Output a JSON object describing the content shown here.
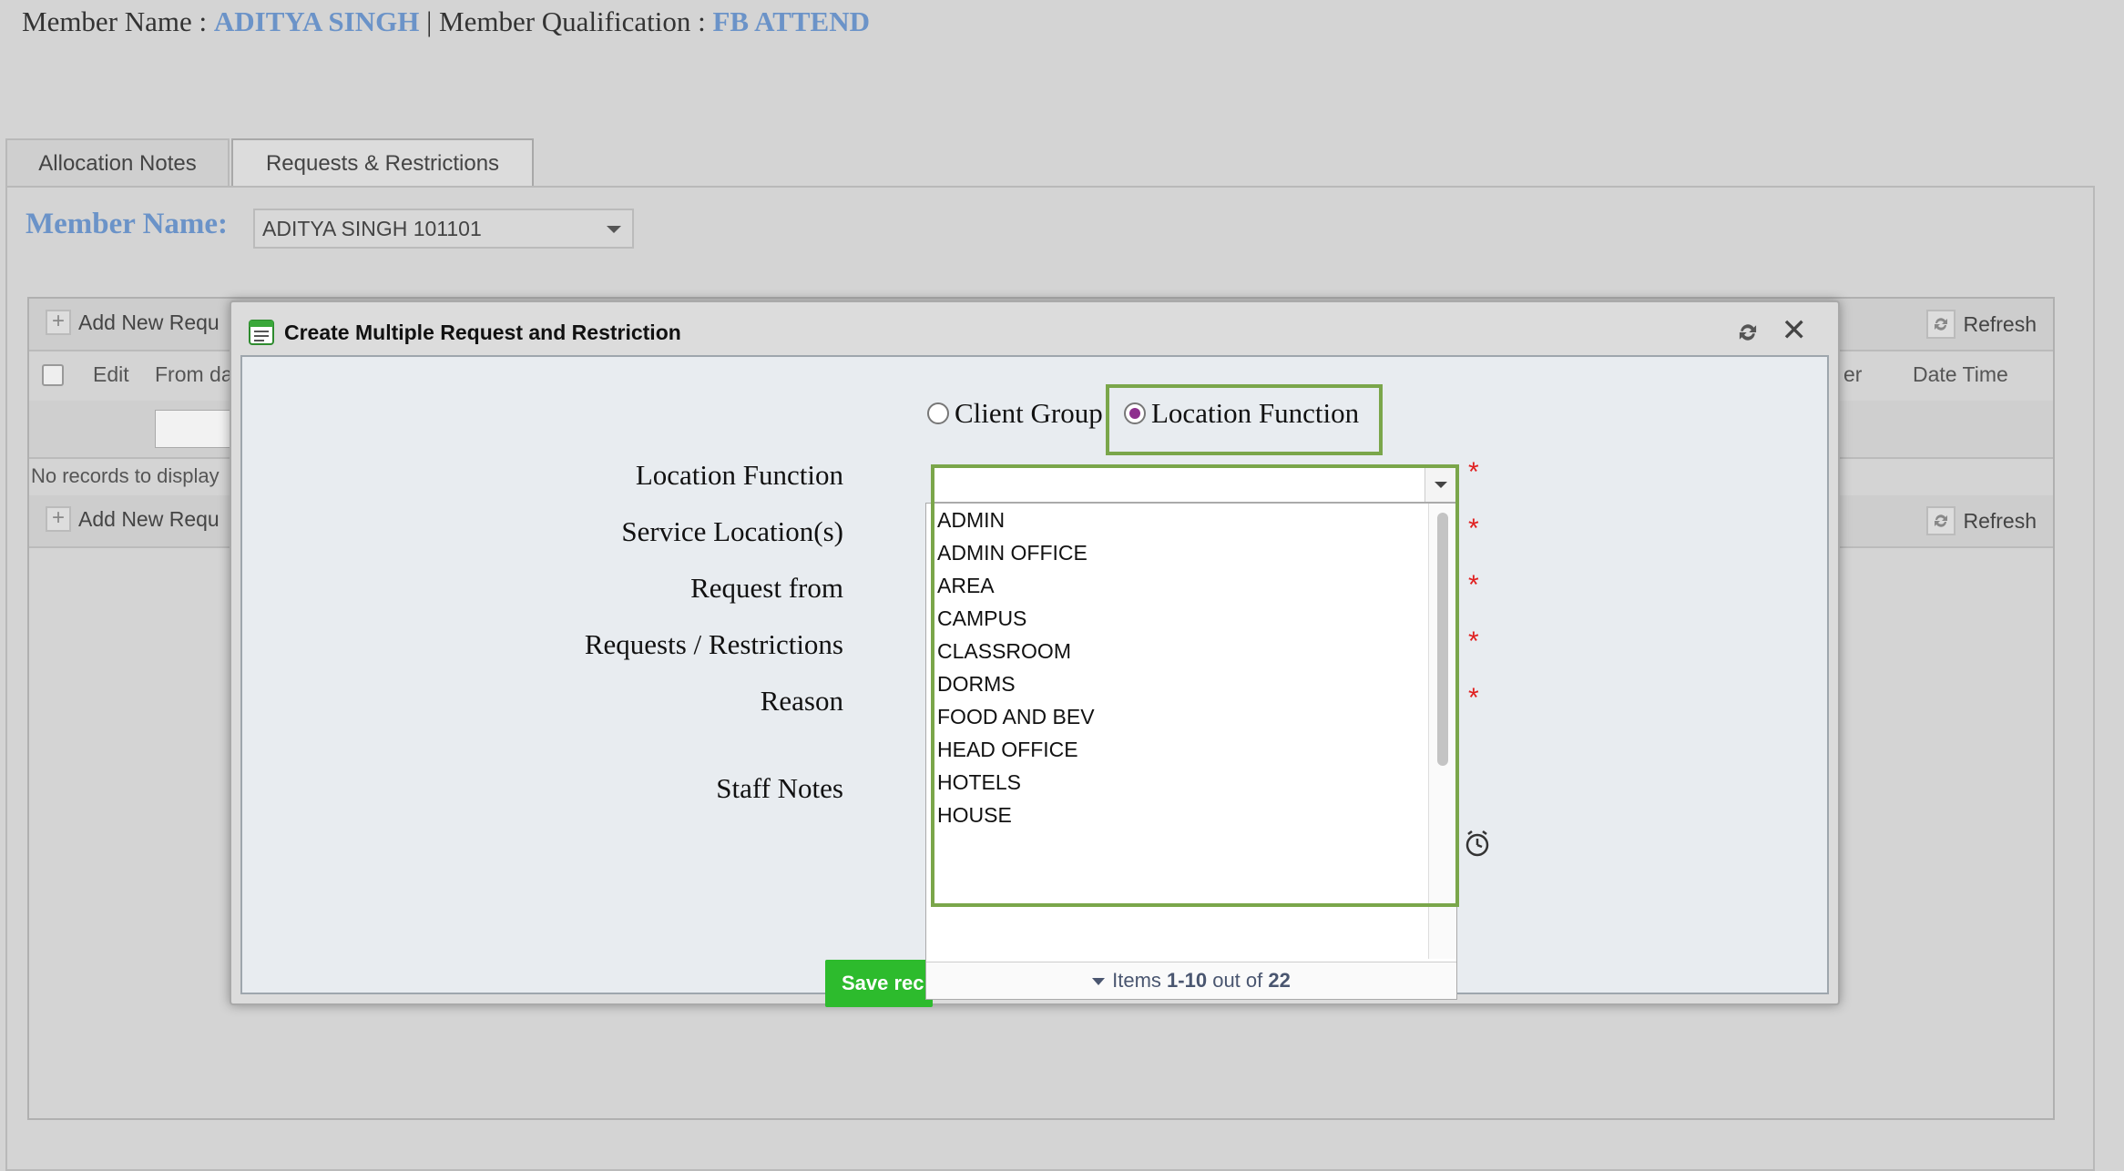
{
  "header": {
    "member_name_label": "Member Name : ",
    "member_name_value": "ADITYA SINGH",
    "separator": " | ",
    "qualification_label": "Member Qualification : ",
    "qualification_value": "FB ATTEND"
  },
  "tabs": [
    {
      "label": "Allocation Notes",
      "active": false
    },
    {
      "label": "Requests & Restrictions",
      "active": true
    }
  ],
  "member_filter": {
    "label": "Member Name:",
    "selected": "ADITYA SINGH 101101"
  },
  "grid": {
    "add_new_label": "Add New Requ",
    "refresh_label": "Refresh",
    "columns": [
      "Edit",
      "From da",
      "er",
      "Date Time"
    ],
    "no_records": "No records to display"
  },
  "modal": {
    "title": "Create Multiple Request and Restriction",
    "radio_options": [
      {
        "label": "Client Group",
        "selected": false
      },
      {
        "label": "Location Function",
        "selected": true
      }
    ],
    "fields": [
      "Location Function",
      "Service Location(s)",
      "Request from",
      "Requests / Restrictions",
      "Reason",
      "Staff Notes"
    ],
    "required_marker": "*",
    "dropdown": {
      "value": "",
      "items": [
        "ADMIN",
        "ADMIN OFFICE",
        "AREA",
        "CAMPUS",
        "CLASSROOM",
        "DORMS",
        "FOOD AND BEV",
        "HEAD OFFICE",
        "HOTELS",
        "HOUSE"
      ],
      "pager_prefix": "Items ",
      "pager_range": "1-10",
      "pager_mid": " out of ",
      "pager_total": "22"
    },
    "save_label": "Save rec"
  },
  "colors": {
    "accent_blue": "#6b93c8",
    "highlight_green": "#7aa64a",
    "save_green": "#2dbb2d",
    "required_red": "#e02020",
    "radio_purple": "#8d2f8d"
  }
}
